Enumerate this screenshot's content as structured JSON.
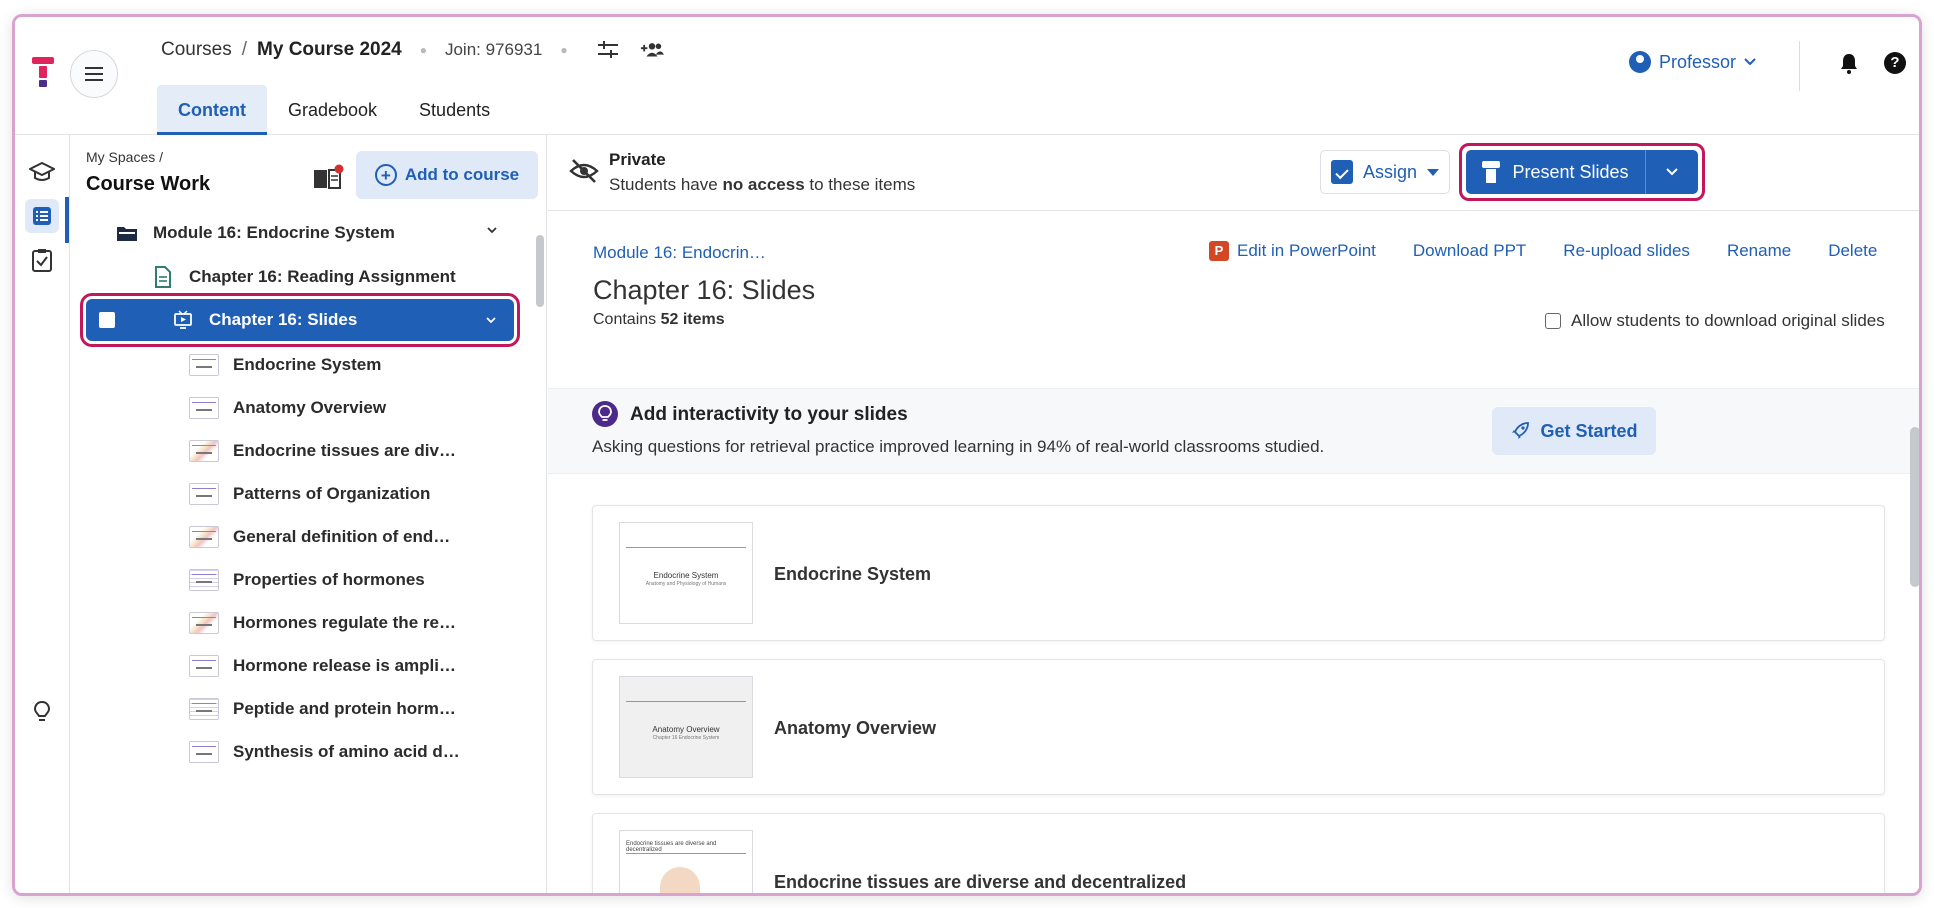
{
  "header": {
    "breadcrumb_root": "Courses",
    "breadcrumb_sep": "/",
    "course_name": "My Course 2024",
    "join_code": "Join: 976931",
    "tabs": [
      {
        "label": "Content",
        "active": true
      },
      {
        "label": "Gradebook",
        "active": false
      },
      {
        "label": "Students",
        "active": false
      }
    ],
    "role": "Professor",
    "help_symbol": "?"
  },
  "sidebar": {
    "space_label": "My Spaces /",
    "space_name": "Course Work",
    "add_button": "Add to course",
    "tree": [
      {
        "label": "Module 16: Endocrine System",
        "kind": "folder"
      },
      {
        "label": "Chapter 16: Reading Assignment",
        "kind": "assignment"
      },
      {
        "label": "Chapter 16: Slides",
        "kind": "slides",
        "selected": true
      },
      {
        "label": "Endocrine System",
        "kind": "slide"
      },
      {
        "label": "Anatomy Overview",
        "kind": "slide"
      },
      {
        "label": "Endocrine tissues are div…",
        "kind": "slide"
      },
      {
        "label": "Patterns of Organization",
        "kind": "slide"
      },
      {
        "label": "General definition of end…",
        "kind": "slide"
      },
      {
        "label": "Properties of hormones",
        "kind": "slide"
      },
      {
        "label": "Hormones regulate the re…",
        "kind": "slide"
      },
      {
        "label": "Hormone release is ampli…",
        "kind": "slide"
      },
      {
        "label": "Peptide and protein horm…",
        "kind": "slide"
      },
      {
        "label": "Synthesis of amino acid d…",
        "kind": "slide"
      }
    ]
  },
  "privacy": {
    "title": "Private",
    "desc_prefix": "Students have",
    "desc_bold": "no access",
    "desc_suffix": "to these items"
  },
  "toolbar": {
    "assign_label": "Assign",
    "present_label": "Present Slides"
  },
  "content": {
    "breadcrumb": "Module 16: Endocrin…",
    "actions": {
      "ppt_icon_letter": "P",
      "edit_ppt": "Edit in PowerPoint",
      "download": "Download PPT",
      "reupload": "Re-upload slides",
      "rename": "Rename",
      "delete": "Delete"
    },
    "title": "Chapter 16: Slides",
    "contains_prefix": "Contains",
    "contains_count": "52 items",
    "allow_download_label": "Allow students to download original slides"
  },
  "promo": {
    "title": "Add interactivity to your slides",
    "desc": "Asking questions for retrieval practice improved learning in 94% of real-world classrooms studied.",
    "button": "Get Started"
  },
  "slides": [
    {
      "title": "Endocrine System",
      "thumb_title": "Endocrine System",
      "thumb_sub": "Anatomy and Physiology of Humans"
    },
    {
      "title": "Anatomy Overview",
      "thumb_title": "Anatomy Overview",
      "thumb_sub": "Chapter 16 Endocrine System"
    },
    {
      "title": "Endocrine tissues are diverse and decentralized",
      "thumb_title": "Endocrine tissues are diverse and decentralized",
      "thumb_sub": ""
    }
  ],
  "colors": {
    "accent": "#1f5fb5",
    "highlight": "#c2185b",
    "brand": "#e0245e"
  }
}
